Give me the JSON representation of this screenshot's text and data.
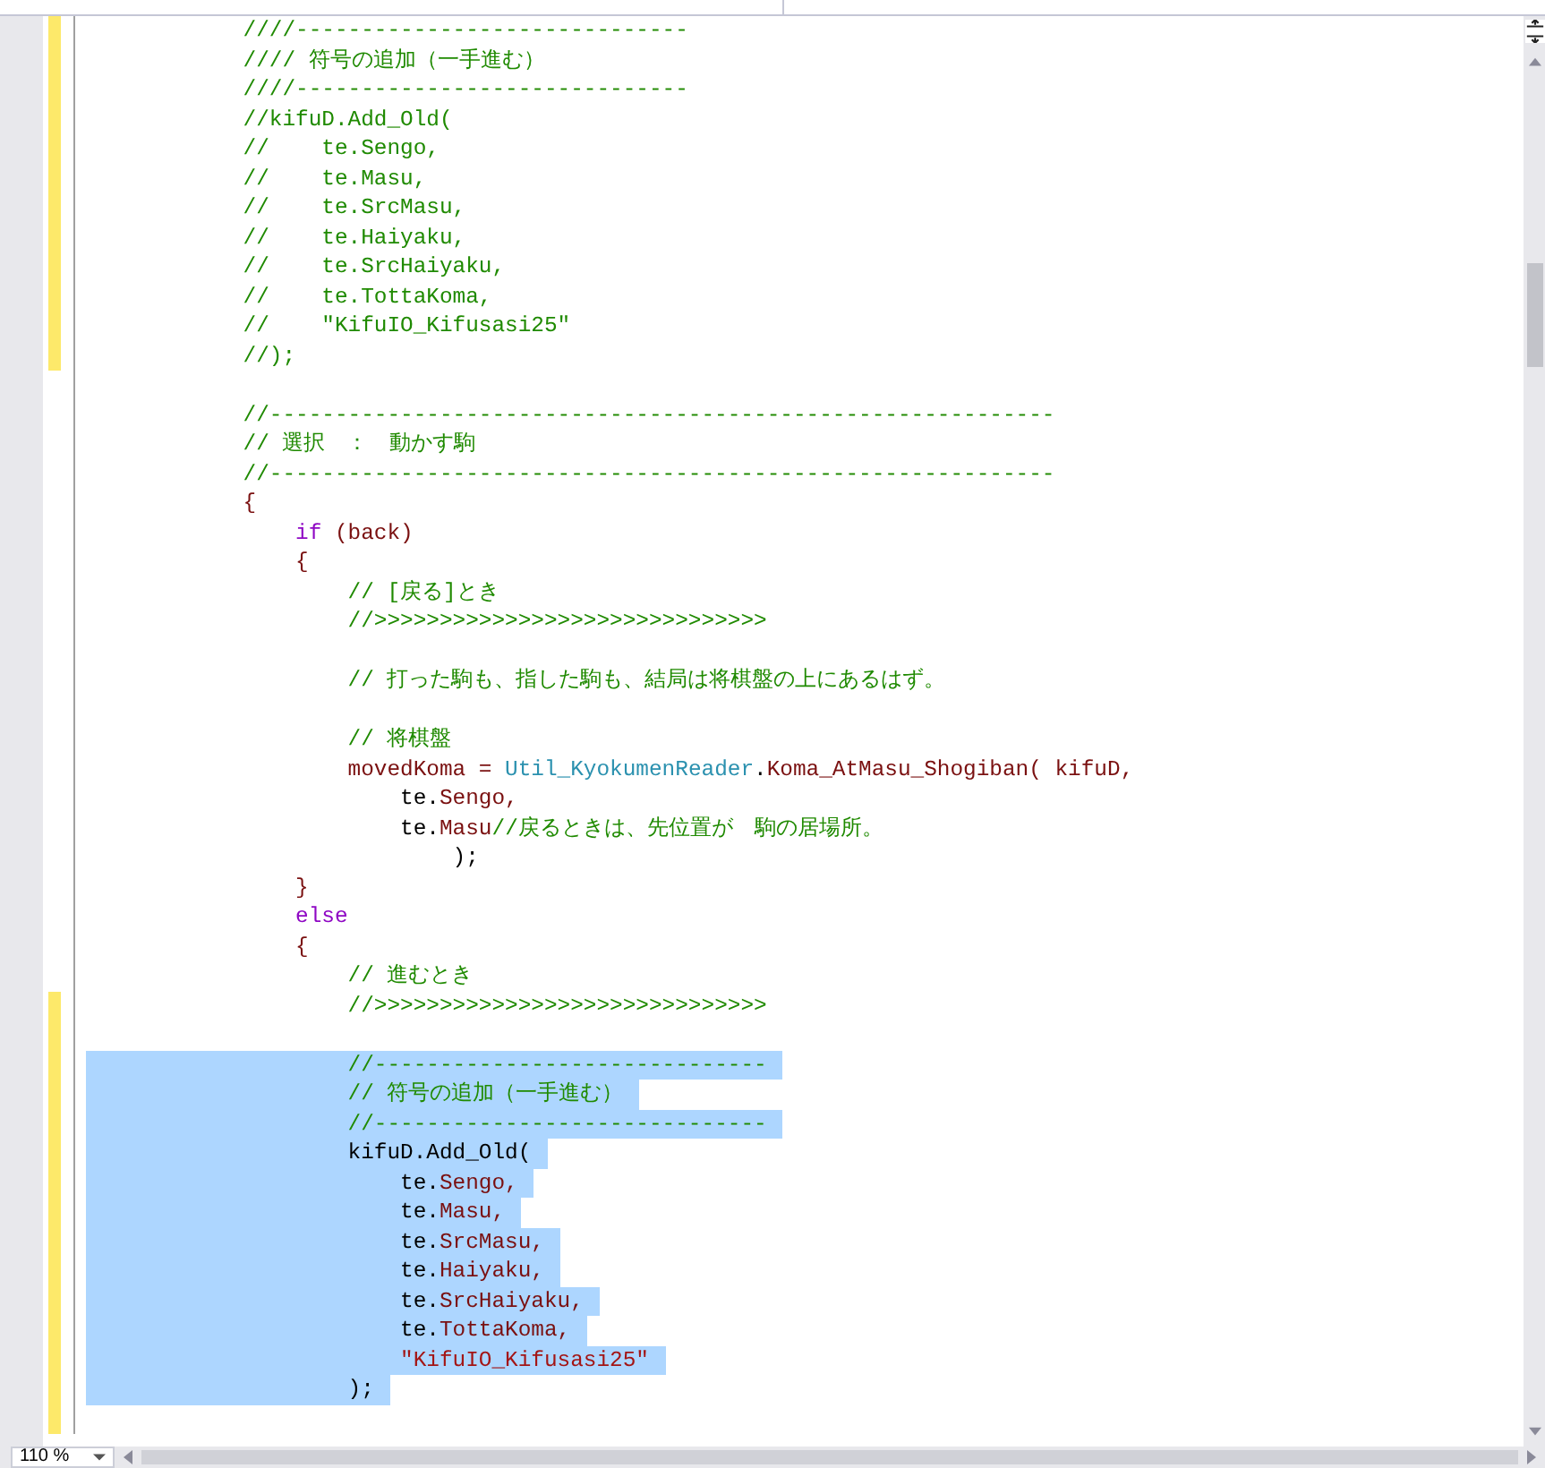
{
  "editor": {
    "lines": [
      {
        "modified": true,
        "selected": false,
        "tokens": [
          {
            "kind": "comment",
            "text": "            ////------------------------------"
          }
        ]
      },
      {
        "modified": true,
        "selected": false,
        "tokens": [
          {
            "kind": "comment",
            "text": "            //// 符号の追加（一手進む）"
          }
        ]
      },
      {
        "modified": true,
        "selected": false,
        "tokens": [
          {
            "kind": "comment",
            "text": "            ////------------------------------"
          }
        ]
      },
      {
        "modified": true,
        "selected": false,
        "tokens": [
          {
            "kind": "comment",
            "text": "            //kifuD.Add_Old("
          }
        ]
      },
      {
        "modified": true,
        "selected": false,
        "tokens": [
          {
            "kind": "comment",
            "text": "            //    te.Sengo,"
          }
        ]
      },
      {
        "modified": true,
        "selected": false,
        "tokens": [
          {
            "kind": "comment",
            "text": "            //    te.Masu,"
          }
        ]
      },
      {
        "modified": true,
        "selected": false,
        "tokens": [
          {
            "kind": "comment",
            "text": "            //    te.SrcMasu,"
          }
        ]
      },
      {
        "modified": true,
        "selected": false,
        "tokens": [
          {
            "kind": "comment",
            "text": "            //    te.Haiyaku,"
          }
        ]
      },
      {
        "modified": true,
        "selected": false,
        "tokens": [
          {
            "kind": "comment",
            "text": "            //    te.SrcHaiyaku,"
          }
        ]
      },
      {
        "modified": true,
        "selected": false,
        "tokens": [
          {
            "kind": "comment",
            "text": "            //    te.TottaKoma,"
          }
        ]
      },
      {
        "modified": true,
        "selected": false,
        "tokens": [
          {
            "kind": "comment",
            "text": "            //    \"KifuIO_Kifusasi25\""
          }
        ]
      },
      {
        "modified": true,
        "selected": false,
        "tokens": [
          {
            "kind": "comment",
            "text": "            //);"
          }
        ]
      },
      {
        "modified": false,
        "selected": false
      },
      {
        "modified": false,
        "selected": false,
        "tokens": [
          {
            "kind": "comment",
            "text": "            //------------------------------------------------------------"
          }
        ]
      },
      {
        "modified": false,
        "selected": false,
        "tokens": [
          {
            "kind": "comment",
            "text": "            // 選択　：　動かす駒"
          }
        ]
      },
      {
        "modified": false,
        "selected": false,
        "tokens": [
          {
            "kind": "comment",
            "text": "            //------------------------------------------------------------"
          }
        ]
      },
      {
        "modified": false,
        "selected": false,
        "tokens": [
          {
            "kind": "ident",
            "text": "            {"
          }
        ]
      },
      {
        "modified": false,
        "selected": false,
        "tokens": [
          {
            "kind": "keyword",
            "text": "                if"
          },
          {
            "kind": "ident",
            "text": " (back)"
          }
        ]
      },
      {
        "modified": false,
        "selected": false,
        "tokens": [
          {
            "kind": "ident",
            "text": "                {"
          }
        ]
      },
      {
        "modified": false,
        "selected": false,
        "tokens": [
          {
            "kind": "comment",
            "text": "                    // [戻る]とき"
          }
        ]
      },
      {
        "modified": false,
        "selected": false,
        "tokens": [
          {
            "kind": "comment",
            "text": "                    //>>>>>>>>>>>>>>>>>>>>>>>>>>>>>>"
          }
        ]
      },
      {
        "modified": false,
        "selected": false
      },
      {
        "modified": false,
        "selected": false,
        "tokens": [
          {
            "kind": "comment",
            "text": "                    // 打った駒も、指した駒も、結局は将棋盤の上にあるはず。"
          }
        ]
      },
      {
        "modified": false,
        "selected": false
      },
      {
        "modified": false,
        "selected": false,
        "tokens": [
          {
            "kind": "comment",
            "text": "                    // 将棋盤"
          }
        ]
      },
      {
        "modified": false,
        "selected": false,
        "tokens": [
          {
            "kind": "ident",
            "text": "                    movedKoma = "
          },
          {
            "kind": "type",
            "text": "Util_KyokumenReader"
          },
          {
            "kind": "plain",
            "text": "."
          },
          {
            "kind": "ident",
            "text": "Koma_AtMasu_Shogiban( kifuD,"
          }
        ]
      },
      {
        "modified": false,
        "selected": false,
        "tokens": [
          {
            "kind": "plain",
            "text": "                        te."
          },
          {
            "kind": "ident",
            "text": "Sengo,"
          }
        ]
      },
      {
        "modified": false,
        "selected": false,
        "tokens": [
          {
            "kind": "plain",
            "text": "                        te."
          },
          {
            "kind": "ident",
            "text": "Masu"
          },
          {
            "kind": "comment",
            "text": "//戻るときは、先位置が　駒の居場所。"
          }
        ]
      },
      {
        "modified": false,
        "selected": false,
        "tokens": [
          {
            "kind": "plain",
            "text": "                            );"
          }
        ]
      },
      {
        "modified": false,
        "selected": false,
        "tokens": [
          {
            "kind": "ident",
            "text": "                }"
          }
        ]
      },
      {
        "modified": false,
        "selected": false,
        "tokens": [
          {
            "kind": "keyword",
            "text": "                else"
          }
        ]
      },
      {
        "modified": false,
        "selected": false,
        "tokens": [
          {
            "kind": "ident",
            "text": "                {"
          }
        ]
      },
      {
        "modified": false,
        "selected": false,
        "tokens": [
          {
            "kind": "comment",
            "text": "                    // 進むとき"
          }
        ]
      },
      {
        "modified": true,
        "selected": false,
        "tokens": [
          {
            "kind": "comment",
            "text": "                    //>>>>>>>>>>>>>>>>>>>>>>>>>>>>>>"
          }
        ]
      },
      {
        "modified": true,
        "selected": false
      },
      {
        "modified": true,
        "selected": true,
        "tokens": [
          {
            "kind": "comment",
            "text": "                    //------------------------------"
          }
        ]
      },
      {
        "modified": true,
        "selected": true,
        "tokens": [
          {
            "kind": "comment",
            "text": "                    // 符号の追加（一手進む）"
          }
        ]
      },
      {
        "modified": true,
        "selected": true,
        "tokens": [
          {
            "kind": "comment",
            "text": "                    //------------------------------"
          }
        ]
      },
      {
        "modified": true,
        "selected": true,
        "tokens": [
          {
            "kind": "plain",
            "text": "                    kifuD.Add_Old("
          }
        ]
      },
      {
        "modified": true,
        "selected": true,
        "tokens": [
          {
            "kind": "plain",
            "text": "                        te."
          },
          {
            "kind": "ident",
            "text": "Sengo,"
          }
        ]
      },
      {
        "modified": true,
        "selected": true,
        "tokens": [
          {
            "kind": "plain",
            "text": "                        te."
          },
          {
            "kind": "ident",
            "text": "Masu,"
          }
        ]
      },
      {
        "modified": true,
        "selected": true,
        "tokens": [
          {
            "kind": "plain",
            "text": "                        te."
          },
          {
            "kind": "ident",
            "text": "SrcMasu,"
          }
        ]
      },
      {
        "modified": true,
        "selected": true,
        "tokens": [
          {
            "kind": "plain",
            "text": "                        te."
          },
          {
            "kind": "ident",
            "text": "Haiyaku,"
          }
        ]
      },
      {
        "modified": true,
        "selected": true,
        "tokens": [
          {
            "kind": "plain",
            "text": "                        te."
          },
          {
            "kind": "ident",
            "text": "SrcHaiyaku,"
          }
        ]
      },
      {
        "modified": true,
        "selected": true,
        "tokens": [
          {
            "kind": "plain",
            "text": "                        te."
          },
          {
            "kind": "ident",
            "text": "TottaKoma,"
          }
        ]
      },
      {
        "modified": true,
        "selected": true,
        "tokens": [
          {
            "kind": "string",
            "text": "                        \"KifuIO_Kifusasi25\""
          }
        ]
      },
      {
        "modified": true,
        "selected": true,
        "tokens": [
          {
            "kind": "plain",
            "text": "                    );"
          }
        ]
      },
      {
        "modified": true,
        "selected": false
      }
    ]
  },
  "status_bar": {
    "zoom": "110 %"
  }
}
